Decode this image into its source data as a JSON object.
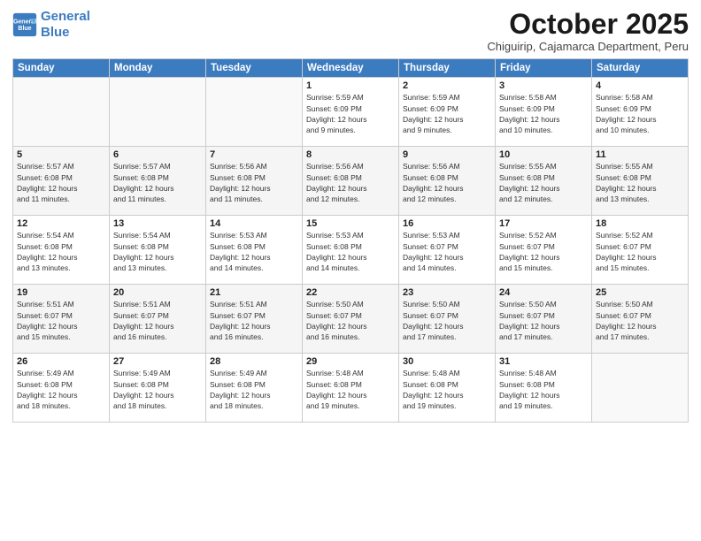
{
  "logo": {
    "line1": "General",
    "line2": "Blue"
  },
  "title": "October 2025",
  "subtitle": "Chiguirip, Cajamarca Department, Peru",
  "headers": [
    "Sunday",
    "Monday",
    "Tuesday",
    "Wednesday",
    "Thursday",
    "Friday",
    "Saturday"
  ],
  "weeks": [
    [
      {
        "day": "",
        "info": ""
      },
      {
        "day": "",
        "info": ""
      },
      {
        "day": "",
        "info": ""
      },
      {
        "day": "1",
        "info": "Sunrise: 5:59 AM\nSunset: 6:09 PM\nDaylight: 12 hours\nand 9 minutes."
      },
      {
        "day": "2",
        "info": "Sunrise: 5:59 AM\nSunset: 6:09 PM\nDaylight: 12 hours\nand 9 minutes."
      },
      {
        "day": "3",
        "info": "Sunrise: 5:58 AM\nSunset: 6:09 PM\nDaylight: 12 hours\nand 10 minutes."
      },
      {
        "day": "4",
        "info": "Sunrise: 5:58 AM\nSunset: 6:09 PM\nDaylight: 12 hours\nand 10 minutes."
      }
    ],
    [
      {
        "day": "5",
        "info": "Sunrise: 5:57 AM\nSunset: 6:08 PM\nDaylight: 12 hours\nand 11 minutes."
      },
      {
        "day": "6",
        "info": "Sunrise: 5:57 AM\nSunset: 6:08 PM\nDaylight: 12 hours\nand 11 minutes."
      },
      {
        "day": "7",
        "info": "Sunrise: 5:56 AM\nSunset: 6:08 PM\nDaylight: 12 hours\nand 11 minutes."
      },
      {
        "day": "8",
        "info": "Sunrise: 5:56 AM\nSunset: 6:08 PM\nDaylight: 12 hours\nand 12 minutes."
      },
      {
        "day": "9",
        "info": "Sunrise: 5:56 AM\nSunset: 6:08 PM\nDaylight: 12 hours\nand 12 minutes."
      },
      {
        "day": "10",
        "info": "Sunrise: 5:55 AM\nSunset: 6:08 PM\nDaylight: 12 hours\nand 12 minutes."
      },
      {
        "day": "11",
        "info": "Sunrise: 5:55 AM\nSunset: 6:08 PM\nDaylight: 12 hours\nand 13 minutes."
      }
    ],
    [
      {
        "day": "12",
        "info": "Sunrise: 5:54 AM\nSunset: 6:08 PM\nDaylight: 12 hours\nand 13 minutes."
      },
      {
        "day": "13",
        "info": "Sunrise: 5:54 AM\nSunset: 6:08 PM\nDaylight: 12 hours\nand 13 minutes."
      },
      {
        "day": "14",
        "info": "Sunrise: 5:53 AM\nSunset: 6:08 PM\nDaylight: 12 hours\nand 14 minutes."
      },
      {
        "day": "15",
        "info": "Sunrise: 5:53 AM\nSunset: 6:08 PM\nDaylight: 12 hours\nand 14 minutes."
      },
      {
        "day": "16",
        "info": "Sunrise: 5:53 AM\nSunset: 6:07 PM\nDaylight: 12 hours\nand 14 minutes."
      },
      {
        "day": "17",
        "info": "Sunrise: 5:52 AM\nSunset: 6:07 PM\nDaylight: 12 hours\nand 15 minutes."
      },
      {
        "day": "18",
        "info": "Sunrise: 5:52 AM\nSunset: 6:07 PM\nDaylight: 12 hours\nand 15 minutes."
      }
    ],
    [
      {
        "day": "19",
        "info": "Sunrise: 5:51 AM\nSunset: 6:07 PM\nDaylight: 12 hours\nand 15 minutes."
      },
      {
        "day": "20",
        "info": "Sunrise: 5:51 AM\nSunset: 6:07 PM\nDaylight: 12 hours\nand 16 minutes."
      },
      {
        "day": "21",
        "info": "Sunrise: 5:51 AM\nSunset: 6:07 PM\nDaylight: 12 hours\nand 16 minutes."
      },
      {
        "day": "22",
        "info": "Sunrise: 5:50 AM\nSunset: 6:07 PM\nDaylight: 12 hours\nand 16 minutes."
      },
      {
        "day": "23",
        "info": "Sunrise: 5:50 AM\nSunset: 6:07 PM\nDaylight: 12 hours\nand 17 minutes."
      },
      {
        "day": "24",
        "info": "Sunrise: 5:50 AM\nSunset: 6:07 PM\nDaylight: 12 hours\nand 17 minutes."
      },
      {
        "day": "25",
        "info": "Sunrise: 5:50 AM\nSunset: 6:07 PM\nDaylight: 12 hours\nand 17 minutes."
      }
    ],
    [
      {
        "day": "26",
        "info": "Sunrise: 5:49 AM\nSunset: 6:08 PM\nDaylight: 12 hours\nand 18 minutes."
      },
      {
        "day": "27",
        "info": "Sunrise: 5:49 AM\nSunset: 6:08 PM\nDaylight: 12 hours\nand 18 minutes."
      },
      {
        "day": "28",
        "info": "Sunrise: 5:49 AM\nSunset: 6:08 PM\nDaylight: 12 hours\nand 18 minutes."
      },
      {
        "day": "29",
        "info": "Sunrise: 5:48 AM\nSunset: 6:08 PM\nDaylight: 12 hours\nand 19 minutes."
      },
      {
        "day": "30",
        "info": "Sunrise: 5:48 AM\nSunset: 6:08 PM\nDaylight: 12 hours\nand 19 minutes."
      },
      {
        "day": "31",
        "info": "Sunrise: 5:48 AM\nSunset: 6:08 PM\nDaylight: 12 hours\nand 19 minutes."
      },
      {
        "day": "",
        "info": ""
      }
    ]
  ]
}
